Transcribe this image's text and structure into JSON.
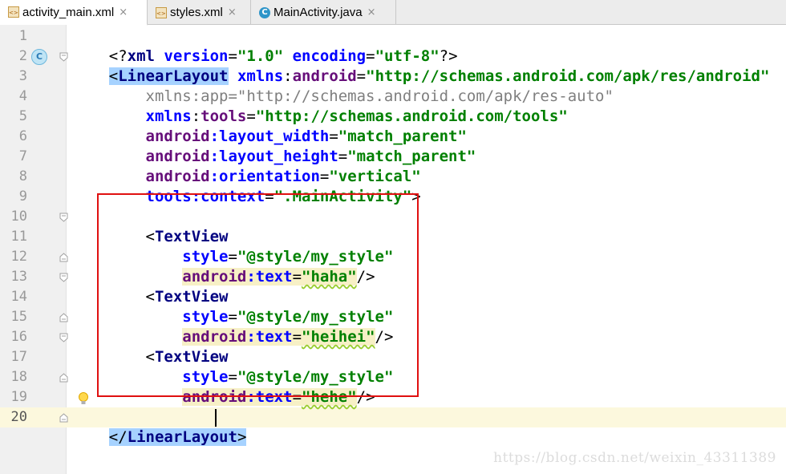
{
  "tabs": [
    {
      "label": "activity_main.xml",
      "close": "×"
    },
    {
      "label": "styles.xml",
      "close": "×"
    },
    {
      "label": "MainActivity.java",
      "close": "×"
    }
  ],
  "gutter": {
    "class_badge": "C",
    "line_numbers": [
      "1",
      "2",
      "3",
      "4",
      "5",
      "6",
      "7",
      "8",
      "9",
      "10",
      "11",
      "12",
      "13",
      "14",
      "15",
      "16",
      "17",
      "18",
      "19",
      "20"
    ]
  },
  "code": {
    "l1": {
      "open": "<?",
      "xml": "xml",
      "version_attr": " version",
      "eq": "=",
      "version_val": "\"1.0\"",
      "encoding_attr": " encoding",
      "encoding_val": "\"utf-8\"",
      "close": "?>"
    },
    "l2": {
      "lt": "<",
      "tag": "LinearLayout",
      "ns": " xmlns",
      "colon": ":",
      "attr": "android",
      "eq": "=",
      "val": "\"http://schemas.android.com/apk/res/android\""
    },
    "l3": {
      "text": "    xmlns:app=\"http://schemas.android.com/apk/res-auto\""
    },
    "l4": {
      "ns": "    xmlns",
      "colon": ":",
      "attr": "tools",
      "eq": "=",
      "val": "\"http://schemas.android.com/tools\""
    },
    "l5": {
      "ns": "    android",
      "attr": ":layout_width",
      "eq": "=",
      "val": "\"match_parent\""
    },
    "l6": {
      "ns": "    android",
      "attr": ":layout_height",
      "eq": "=",
      "val": "\"match_parent\""
    },
    "l7": {
      "ns": "    android",
      "attr": ":orientation",
      "eq": "=",
      "val": "\"vertical\""
    },
    "l8": {
      "ns": "    tools",
      "attr": ":context",
      "eq": "=",
      "val": "\".MainActivity\"",
      "end": ">"
    },
    "l10": {
      "lt": "    <",
      "tag": "TextView"
    },
    "l11": {
      "attr": "        style",
      "eq": "=",
      "val": "\"@style/my_style\""
    },
    "l12": {
      "indent": "        ",
      "ns": "android",
      "attr": ":text",
      "eq": "=",
      "val": "\"haha\"",
      "end": "/>"
    },
    "l13": {
      "lt": "    <",
      "tag": "TextView"
    },
    "l14": {
      "attr": "        style",
      "eq": "=",
      "val": "\"@style/my_style\""
    },
    "l15": {
      "indent": "        ",
      "ns": "android",
      "attr": ":text",
      "eq": "=",
      "val": "\"heihei\"",
      "end": "/>"
    },
    "l16": {
      "lt": "    <",
      "tag": "TextView"
    },
    "l17": {
      "attr": "        style",
      "eq": "=",
      "val": "\"@style/my_style\""
    },
    "l18": {
      "indent": "        ",
      "ns": "android",
      "attr": ":text",
      "eq": "=",
      "val": "\"hehe\"",
      "end": "/>"
    },
    "l20": {
      "lt": "</",
      "tag": "LinearLayout",
      "gt": ">"
    }
  },
  "watermark": "https://blog.csdn.net/weixin_43311389",
  "colors": {
    "tag": "#000080",
    "attr": "#0000ff",
    "namespace": "#660e7a",
    "value": "#008000",
    "highlight_box": "#e01010"
  },
  "icons": [
    "xml-file-icon",
    "java-class-icon",
    "close-icon",
    "fold-marker-icon",
    "lightbulb-icon"
  ]
}
